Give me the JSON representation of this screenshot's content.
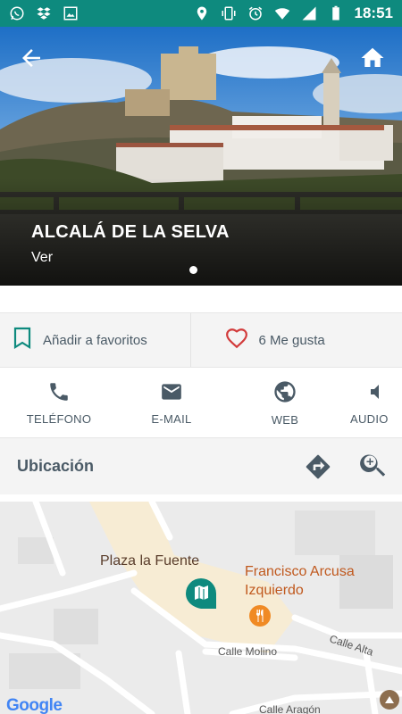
{
  "status_bar": {
    "time": "18:51",
    "icons": [
      "whatsapp-icon",
      "dropbox-icon",
      "image-icon",
      "location-icon",
      "vibrate-icon",
      "alarm-icon",
      "wifi-icon",
      "signal-icon",
      "battery-icon"
    ]
  },
  "hero": {
    "title": "ALCALÁ DE LA SELVA",
    "subtitle": "Ver"
  },
  "actions": {
    "favorites_label": "Añadir a favoritos",
    "likes_label": "6 Me gusta"
  },
  "contact": {
    "phone_label": "TELÉFONO",
    "email_label": "E-MAIL",
    "web_label": "WEB",
    "audio_label": "AUDIO"
  },
  "location": {
    "label": "Ubicación"
  },
  "map": {
    "place_1": "Plaza la Fuente",
    "place_2_line1": "Francisco Arcusa",
    "place_2_line2": "Izquierdo",
    "street_1": "Calle Molino",
    "street_2": "Calle Alta",
    "street_3": "Calle Aragón",
    "google_logo": "Google",
    "colors": {
      "accent": "#0e8a7e",
      "restaurant": "#f08a24",
      "label_brown": "#c0591e"
    }
  }
}
